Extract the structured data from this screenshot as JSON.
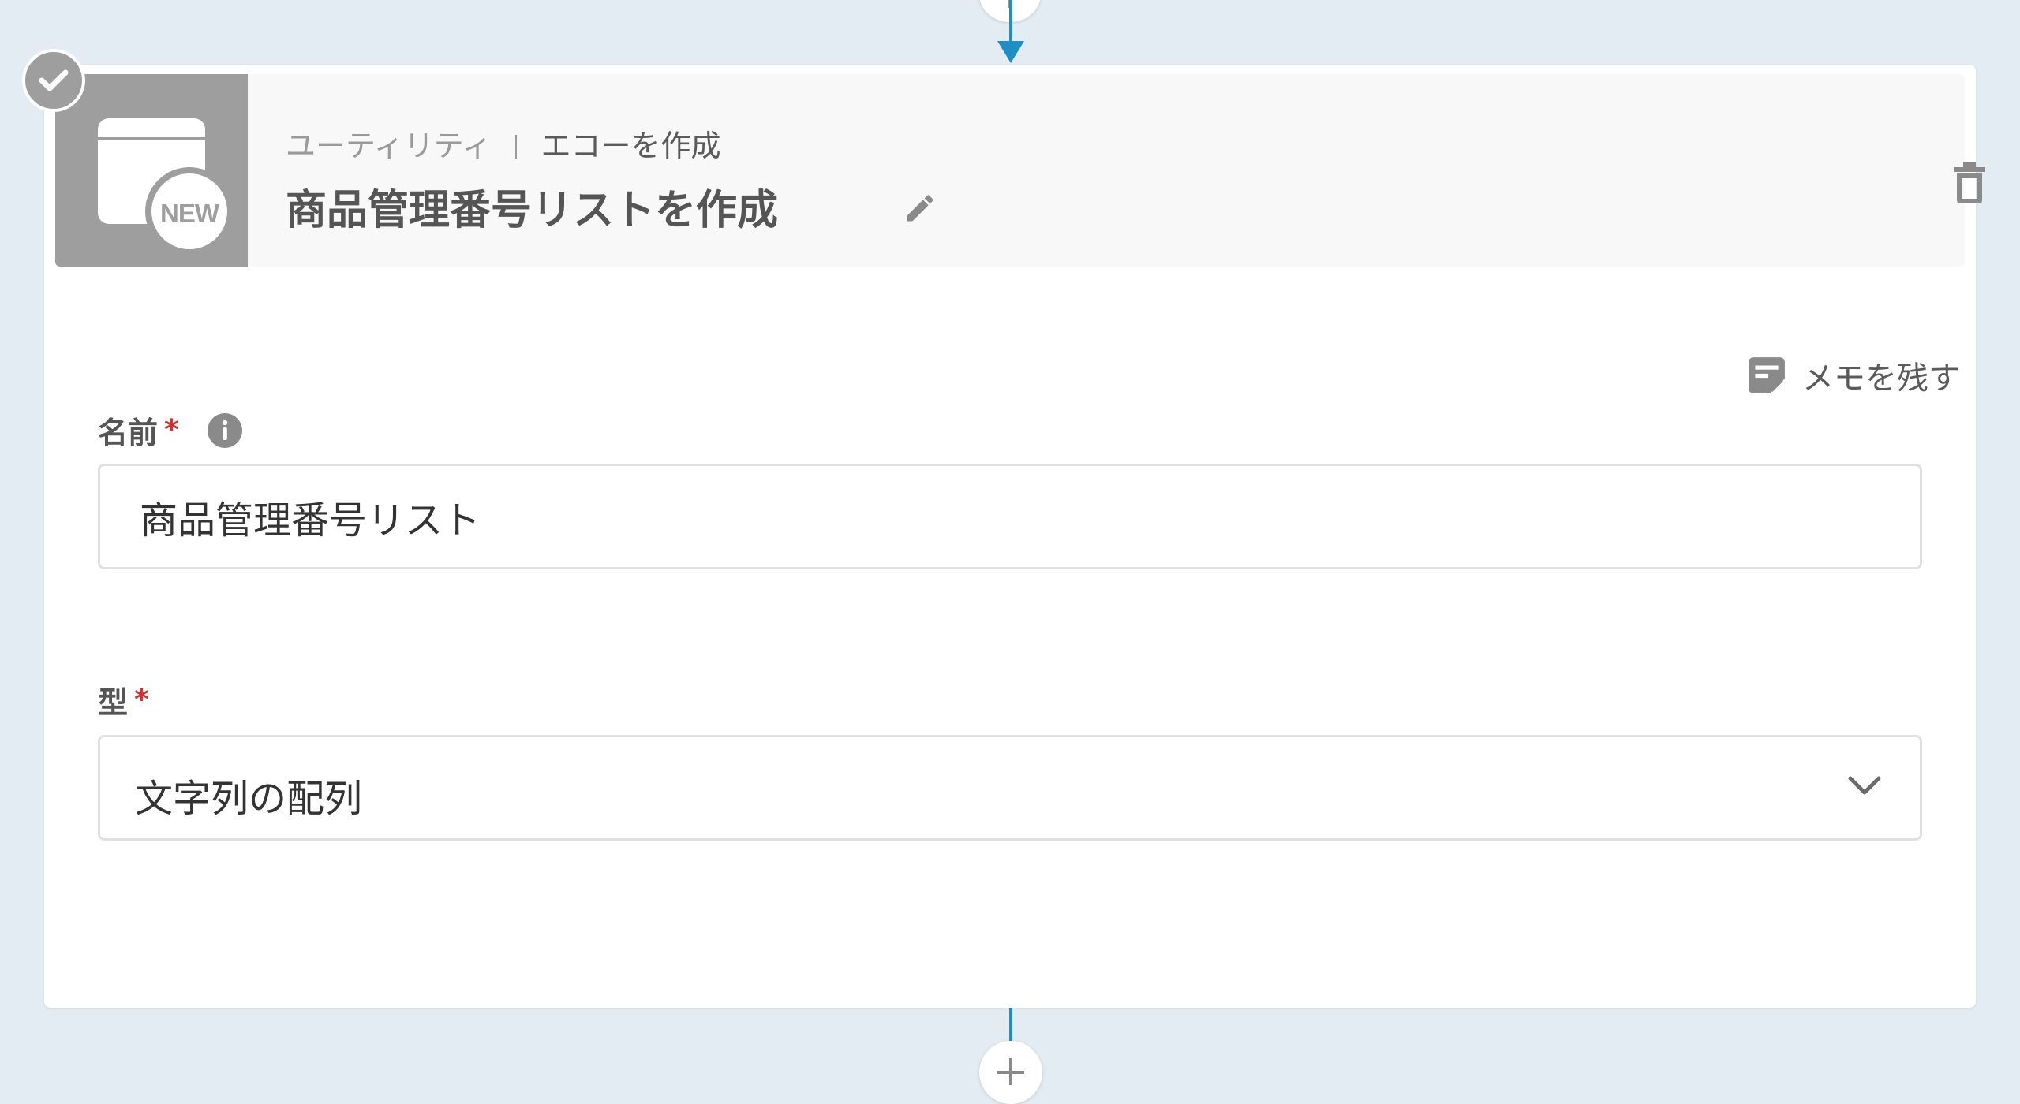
{
  "step": {
    "app_name": "ユーティリティ",
    "action_name": "エコーを作成",
    "title": "商品管理番号リストを作成",
    "icon_badge": "NEW"
  },
  "memo": {
    "label": "メモを残す"
  },
  "fields": {
    "name": {
      "label": "名前",
      "required_mark": "*",
      "value": "商品管理番号リスト"
    },
    "type": {
      "label": "型",
      "required_mark": "*",
      "selected": "文字列の配列"
    }
  },
  "colors": {
    "background": "#e4ecf3",
    "connector": "#1e8fc6",
    "icon_gray": "#9e9e9e",
    "required": "#d0312d"
  },
  "icons": {
    "status": "check-circle-icon",
    "app": "new-box-icon",
    "edit": "pencil-icon",
    "delete": "trash-icon",
    "memo": "note-icon",
    "info": "info-icon",
    "dropdown": "chevron-down-icon",
    "add": "plus-icon"
  }
}
